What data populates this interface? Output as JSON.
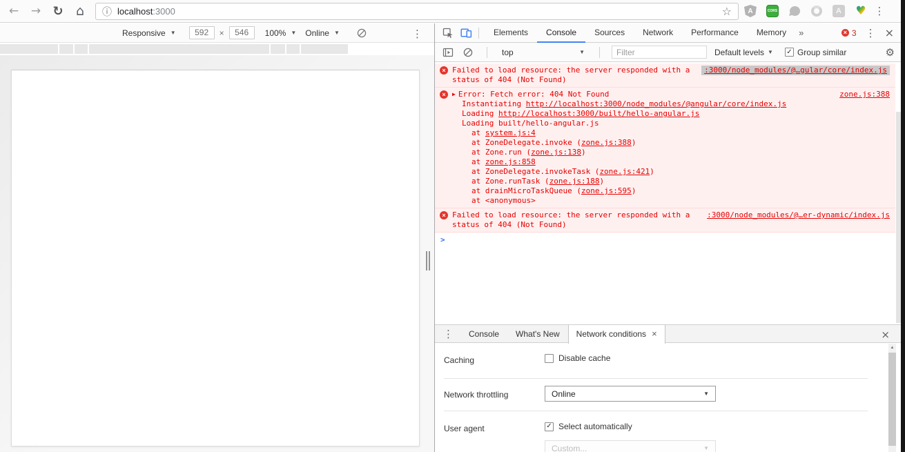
{
  "colors": {
    "accent_blue": "#4285f4",
    "error_red": "#e60000",
    "error_row_bg": "#fff0f0",
    "cors_green": "#3dae3d"
  },
  "icons": {
    "back": "←",
    "forward": "→",
    "reload": "↻",
    "home": "⌂",
    "info": "ⓘ",
    "star": "☆",
    "menu_dots": "⋮",
    "close": "×",
    "dropdown_arrow": "▼",
    "more_tabs": "»",
    "gear": "⚙",
    "scroll_up": "▲",
    "prompt": ">",
    "expand": "▶",
    "heart": "♥",
    "error_x": "×",
    "check": "✓",
    "multiply": "×"
  },
  "browser": {
    "url_host": "localhost",
    "url_port": ":3000",
    "extensions": {
      "angular_letter": "A",
      "cors_label": "CORS",
      "acrobat_letter": "A"
    }
  },
  "device_toolbar": {
    "mode_label": "Responsive",
    "width_value": "592",
    "height_value": "546",
    "zoom_value": "100%",
    "throttle_value": "Online",
    "ruler_segments": [
      [
        0,
        84
      ],
      [
        86,
        20
      ],
      [
        108,
        19
      ],
      [
        129,
        261
      ],
      [
        392,
        21
      ],
      [
        415,
        19
      ],
      [
        436,
        68
      ]
    ]
  },
  "devtools": {
    "tabs": [
      "Elements",
      "Console",
      "Sources",
      "Network",
      "Performance",
      "Memory"
    ],
    "active_tab": "Console",
    "error_count": "3",
    "console_toolbar": {
      "context": "top",
      "filter_placeholder": "Filter",
      "levels_label": "Default levels",
      "group_label": "Group similar",
      "group_checked": true
    },
    "console": {
      "messages": [
        {
          "type": "simple",
          "line1": "Failed to load resource: the server responded with a",
          "line2": "status of 404 (Not Found)",
          "source_link": ":3000/node_modules/@…gular/core/index.js",
          "source_highlighted": true
        },
        {
          "type": "expandable",
          "title": "Error: Fetch error: 404 Not Found",
          "source_link": "zone.js:388",
          "stack": [
            {
              "indent": 1,
              "pre": "Instantiating ",
              "link": "http://localhost:3000/node_modules/@angular/core/index.js",
              "post": ""
            },
            {
              "indent": 1,
              "pre": "Loading ",
              "link": "http://localhost:3000/built/hello-angular.js",
              "post": ""
            },
            {
              "indent": 1,
              "pre": "Loading built/hello-angular.js",
              "link": "",
              "post": ""
            },
            {
              "indent": 2,
              "pre": "at ",
              "link": "system.js:4",
              "post": ""
            },
            {
              "indent": 2,
              "pre": "at ZoneDelegate.invoke (",
              "link": "zone.js:388",
              "post": ")"
            },
            {
              "indent": 2,
              "pre": "at Zone.run (",
              "link": "zone.js:138",
              "post": ")"
            },
            {
              "indent": 2,
              "pre": "at ",
              "link": "zone.js:858",
              "post": ""
            },
            {
              "indent": 2,
              "pre": "at ZoneDelegate.invokeTask (",
              "link": "zone.js:421",
              "post": ")"
            },
            {
              "indent": 2,
              "pre": "at Zone.runTask (",
              "link": "zone.js:188",
              "post": ")"
            },
            {
              "indent": 2,
              "pre": "at drainMicroTaskQueue (",
              "link": "zone.js:595",
              "post": ")"
            },
            {
              "indent": 2,
              "pre": "at <anonymous>",
              "link": "",
              "post": ""
            }
          ]
        },
        {
          "type": "simple",
          "line1": "Failed to load resource: the server responded with a",
          "line2": "status of 404 (Not Found)",
          "source_link": ":3000/node_modules/@…er-dynamic/index.js",
          "source_highlighted": false
        }
      ]
    },
    "drawer": {
      "tabs": [
        {
          "label": "Console",
          "active": false
        },
        {
          "label": "What's New",
          "active": false
        },
        {
          "label": "Network conditions",
          "active": true,
          "closable": true
        }
      ],
      "caching": {
        "label": "Caching",
        "checkbox_label": "Disable cache",
        "checked": false
      },
      "throttling": {
        "label": "Network throttling",
        "value": "Online"
      },
      "user_agent": {
        "label": "User agent",
        "checkbox_label": "Select automatically",
        "checked": true,
        "custom_value": "Custom..."
      }
    }
  }
}
